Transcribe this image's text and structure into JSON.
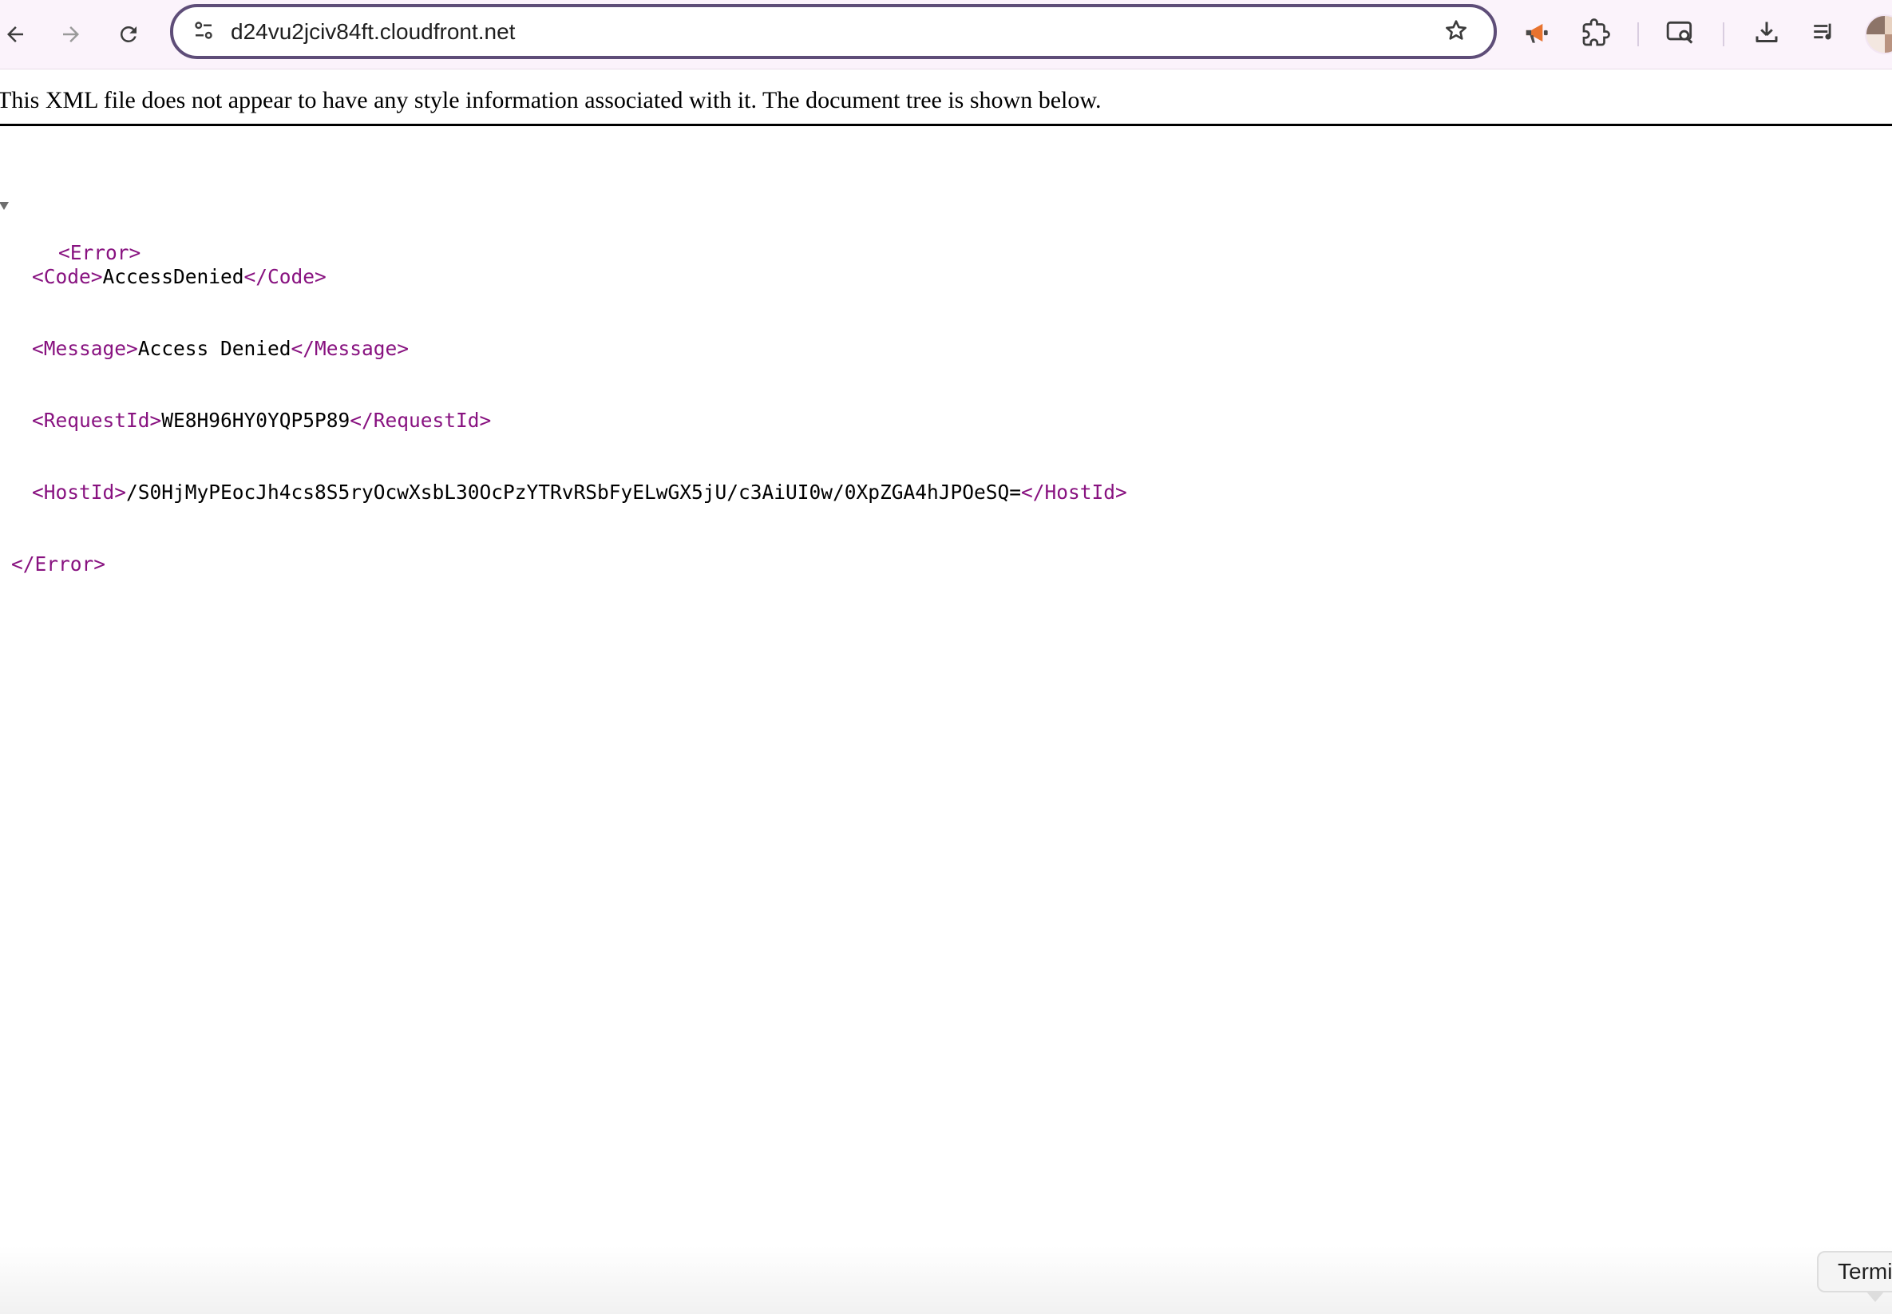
{
  "browser": {
    "url": "d24vu2jciv84ft.cloudfront.net",
    "icons": {
      "back": "arrow-left-icon",
      "forward": "arrow-right-icon",
      "reload": "reload-icon",
      "site_info": "tune-icon",
      "bookmark": "star-icon",
      "extensions": [
        "megaphone-icon",
        "puzzle-icon",
        "lens-search-icon",
        "download-icon",
        "media-queue-icon"
      ],
      "profile": "avatar"
    }
  },
  "page": {
    "notice": "This XML file does not appear to have any style information associated with it. The document tree is shown below.",
    "xml": {
      "root_open": "<Error>",
      "root_close": "</Error>",
      "children": [
        {
          "open": "<Code>",
          "value": "AccessDenied",
          "close": "</Code>"
        },
        {
          "open": "<Message>",
          "value": "Access Denied",
          "close": "</Message>"
        },
        {
          "open": "<RequestId>",
          "value": "WE8H96HY0YQP5P89",
          "close": "</RequestId>"
        },
        {
          "open": "<HostId>",
          "value": "/S0HjMyPEocJh4cs8S5ryOcwXsbL30OcPzYTRvRSbFyELwGX5jU/c3AiUI0w/0XpZGA4hJPOeSQ=",
          "close": "</HostId>"
        }
      ]
    }
  },
  "dock_tooltip": {
    "label": "Termi"
  },
  "colors": {
    "toolbar_bg": "#fbf3fb",
    "omnibox_border": "#5e4d78",
    "xml_tag": "#881280"
  }
}
